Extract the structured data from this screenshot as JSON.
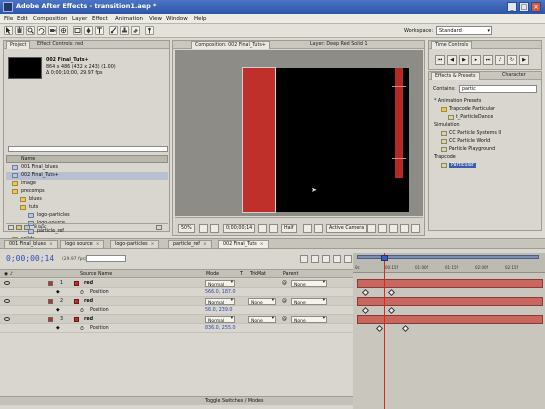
{
  "window": {
    "title": "Adobe After Effects - transition1.aep *"
  },
  "menu": [
    "File",
    "Edit",
    "Composition",
    "Layer",
    "Effect",
    "Animation",
    "View",
    "Window",
    "Help"
  ],
  "toolbar": {
    "workspace_label": "Workspace:",
    "workspace_value": "Standard"
  },
  "project": {
    "tabs": [
      "Project",
      "Effect Controls: red"
    ],
    "selected_name": "002 Final_Tuts+",
    "selected_info_1": "864 x 486 (432 x 243) (1.00)",
    "selected_info_2": "Δ 0;00;10;00, 29.97 fps",
    "column_name": "Name",
    "items": [
      {
        "label": "001 Final_blues",
        "kind": "comp",
        "indent": 0,
        "selected": false
      },
      {
        "label": "002 Final_Tuts+",
        "kind": "comp",
        "indent": 0,
        "selected": true
      },
      {
        "label": "image",
        "kind": "folder",
        "indent": 0,
        "selected": false
      },
      {
        "label": "precomps",
        "kind": "folder",
        "indent": 0,
        "selected": false
      },
      {
        "label": "blues",
        "kind": "folder",
        "indent": 1,
        "selected": false
      },
      {
        "label": "tuts",
        "kind": "folder",
        "indent": 1,
        "selected": false
      },
      {
        "label": "logo-particles",
        "kind": "comp",
        "indent": 2,
        "selected": false
      },
      {
        "label": "logo-source",
        "kind": "comp",
        "indent": 2,
        "selected": false
      },
      {
        "label": "particle_ref",
        "kind": "comp",
        "indent": 2,
        "selected": false
      },
      {
        "label": "solids",
        "kind": "folder",
        "indent": 0,
        "selected": false
      }
    ],
    "bpc": "8 bpc"
  },
  "composition": {
    "tabs": [
      "Composition: 002 Final_Tuts+",
      "Layer: Deep Red Solid 1"
    ],
    "zoom": "50%",
    "timecode": "0;00;00;14",
    "resolution": "Half",
    "camera": "Active Camera"
  },
  "time_controls": {
    "tab": "Time Controls"
  },
  "effects": {
    "tabs": [
      "Effects & Presets",
      "Character"
    ],
    "contains_label": "Contains:",
    "search_value": "partic",
    "items": [
      {
        "label": "* Animation Presets",
        "kind": "none",
        "indent": 0,
        "selected": false
      },
      {
        "label": "Trapcode Particular",
        "kind": "folder",
        "indent": 1,
        "selected": false
      },
      {
        "label": "t_ParticleDance",
        "kind": "fx",
        "indent": 2,
        "selected": false
      },
      {
        "label": "Simulation",
        "kind": "none",
        "indent": 0,
        "selected": false
      },
      {
        "label": "CC Particle Systems II",
        "kind": "fx",
        "indent": 1,
        "selected": false
      },
      {
        "label": "CC Particle World",
        "kind": "fx",
        "indent": 1,
        "selected": false
      },
      {
        "label": "Particle Playground",
        "kind": "fx",
        "indent": 1,
        "selected": false
      },
      {
        "label": "Trapcode",
        "kind": "none",
        "indent": 0,
        "selected": false
      },
      {
        "label": "Particular",
        "kind": "fx",
        "indent": 1,
        "selected": true
      }
    ]
  },
  "comp_tabs": [
    {
      "label": "001 Final_blues",
      "active": false
    },
    {
      "label": "logo source",
      "active": false
    },
    {
      "label": "logo-particles",
      "active": false
    },
    {
      "label": "particle_ref",
      "active": false
    },
    {
      "label": "002 Final_Tuts",
      "active": true
    }
  ],
  "timeline": {
    "timecode": "0;00;00;14",
    "fps": "(29.97 fps)",
    "headers": {
      "source_name": "Source Name",
      "mode": "Mode",
      "t": "T",
      "trkmat": "TrkMat",
      "parent": "Parent"
    },
    "layers": [
      {
        "num": "1",
        "name": "red",
        "mode": "Normal",
        "trkmat": "",
        "parent": "None",
        "kind": "layer"
      },
      {
        "num": "",
        "name": "Position",
        "value": "566.0, 187.0",
        "kind": "prop"
      },
      {
        "num": "2",
        "name": "red",
        "mode": "Normal",
        "trkmat": "None",
        "parent": "None",
        "kind": "layer"
      },
      {
        "num": "",
        "name": "Position",
        "value": "56.0, 239.0",
        "kind": "prop"
      },
      {
        "num": "3",
        "name": "red",
        "mode": "Normal",
        "trkmat": "None",
        "parent": "None",
        "kind": "layer"
      },
      {
        "num": "",
        "name": "Position",
        "value": "836.0, 255.0",
        "kind": "prop"
      }
    ],
    "ruler_ticks": [
      "0s",
      "00:15f",
      "01:00f",
      "01:15f",
      "02:00f",
      "02:15f"
    ],
    "toggle_label": "Toggle Switches / Modes"
  },
  "colors": {
    "layer_red": "#c0302a",
    "timecode_blue": "#2c4fb8",
    "playhead": "#d52a22"
  }
}
